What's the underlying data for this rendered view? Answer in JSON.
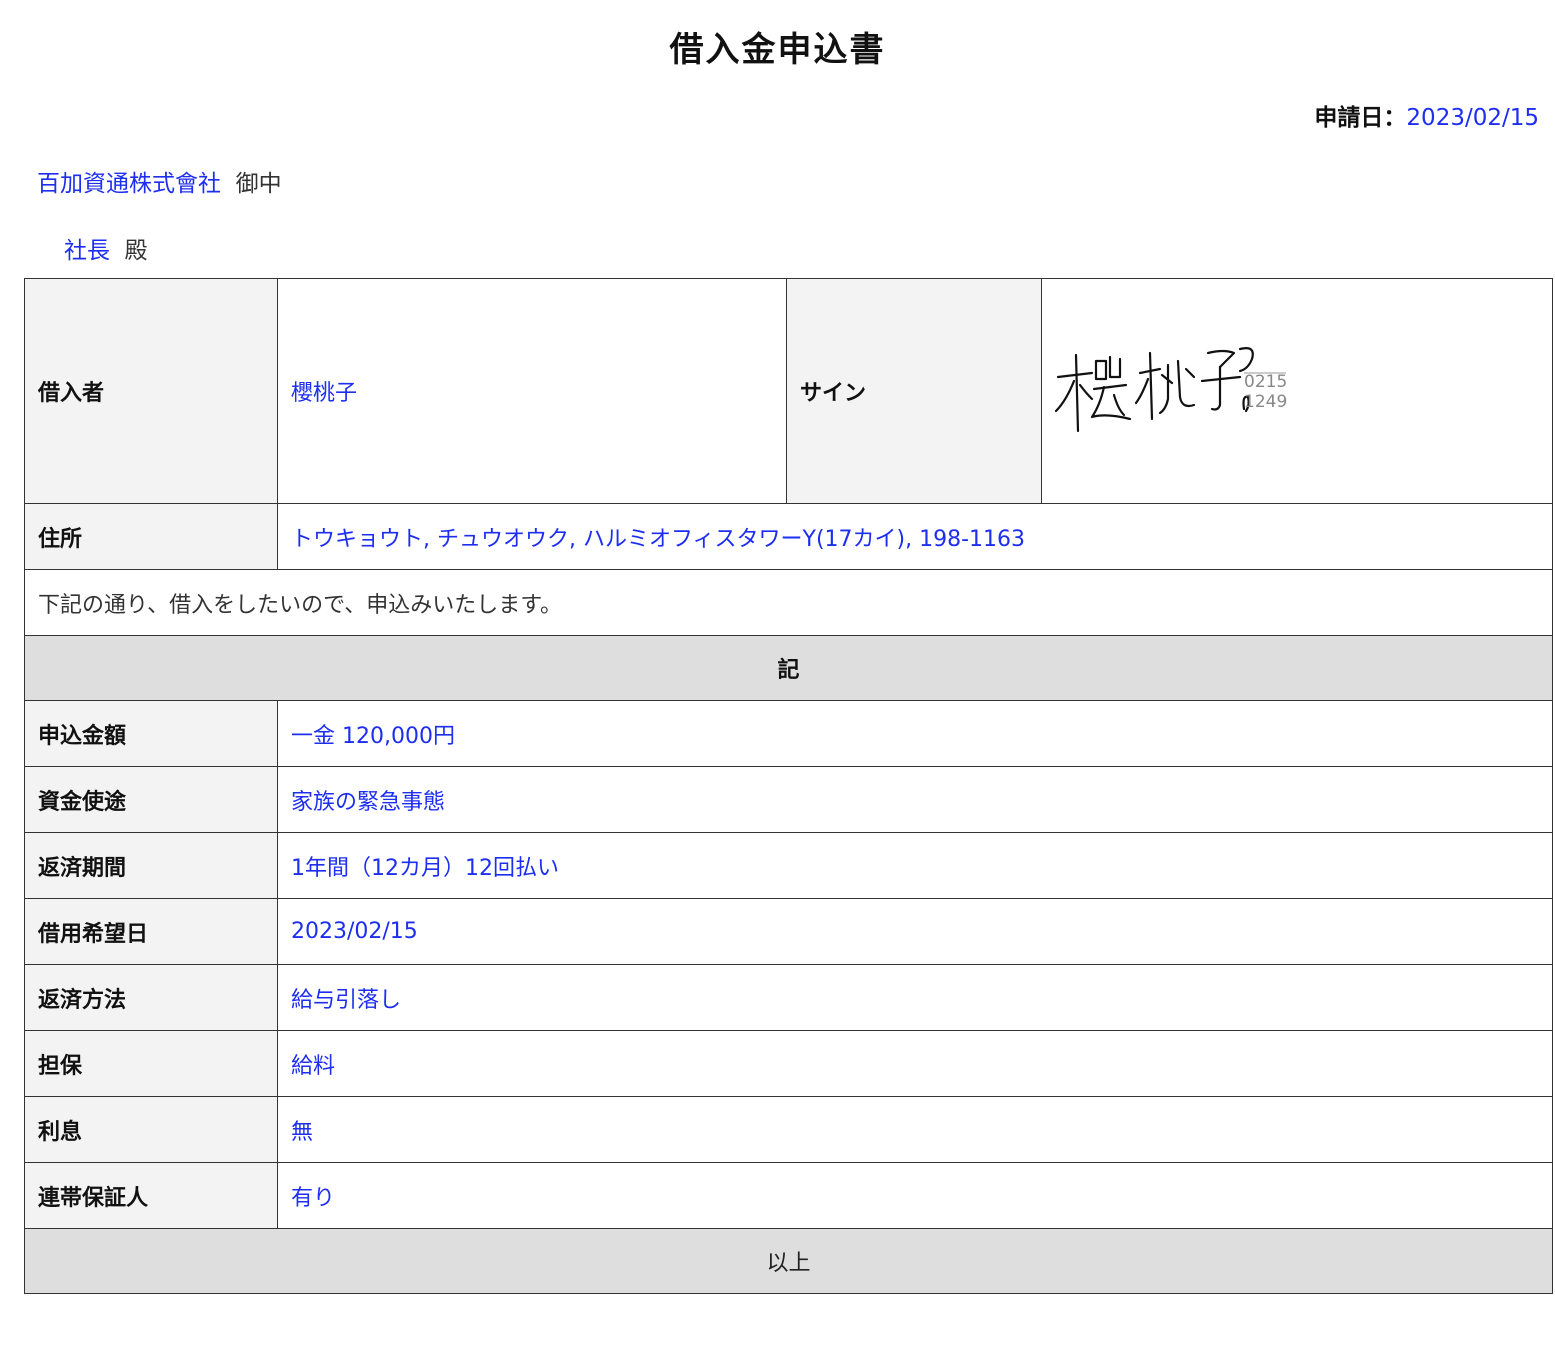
{
  "document": {
    "title": "借入金申込書",
    "apply_date_label": "申請日：",
    "apply_date": "2023/02/15",
    "company": "百加資通株式會社",
    "company_suffix": "御中",
    "recipient": "社長",
    "recipient_suffix": "殿"
  },
  "applicant": {
    "borrower_label": "借入者",
    "borrower": "櫻桃子",
    "sign_label": "サイン",
    "signature": {
      "text": "櫻桃子",
      "stamp_line1": "0215",
      "stamp_line2": "1249"
    },
    "address_label": "住所",
    "address": "トウキョウト, チュウオウク, ハルミオフィスタワーY(17カイ), 198-1163"
  },
  "statement": "下記の通り、借入をしたいので、申込みいたします。",
  "section_header": "記",
  "items": [
    {
      "label": "申込金額",
      "value": "一金 120,000円"
    },
    {
      "label": "資金使途",
      "value": "家族の緊急事態"
    },
    {
      "label": "返済期間",
      "value": "1年間（12カ月）12回払い"
    },
    {
      "label": "借用希望日",
      "value": "2023/02/15"
    },
    {
      "label": "返済方法",
      "value": "給与引落し"
    },
    {
      "label": "担保",
      "value": "給料"
    },
    {
      "label": "利息",
      "value": "無"
    },
    {
      "label": "連帯保証人",
      "value": "有り"
    }
  ],
  "footer": "以上"
}
